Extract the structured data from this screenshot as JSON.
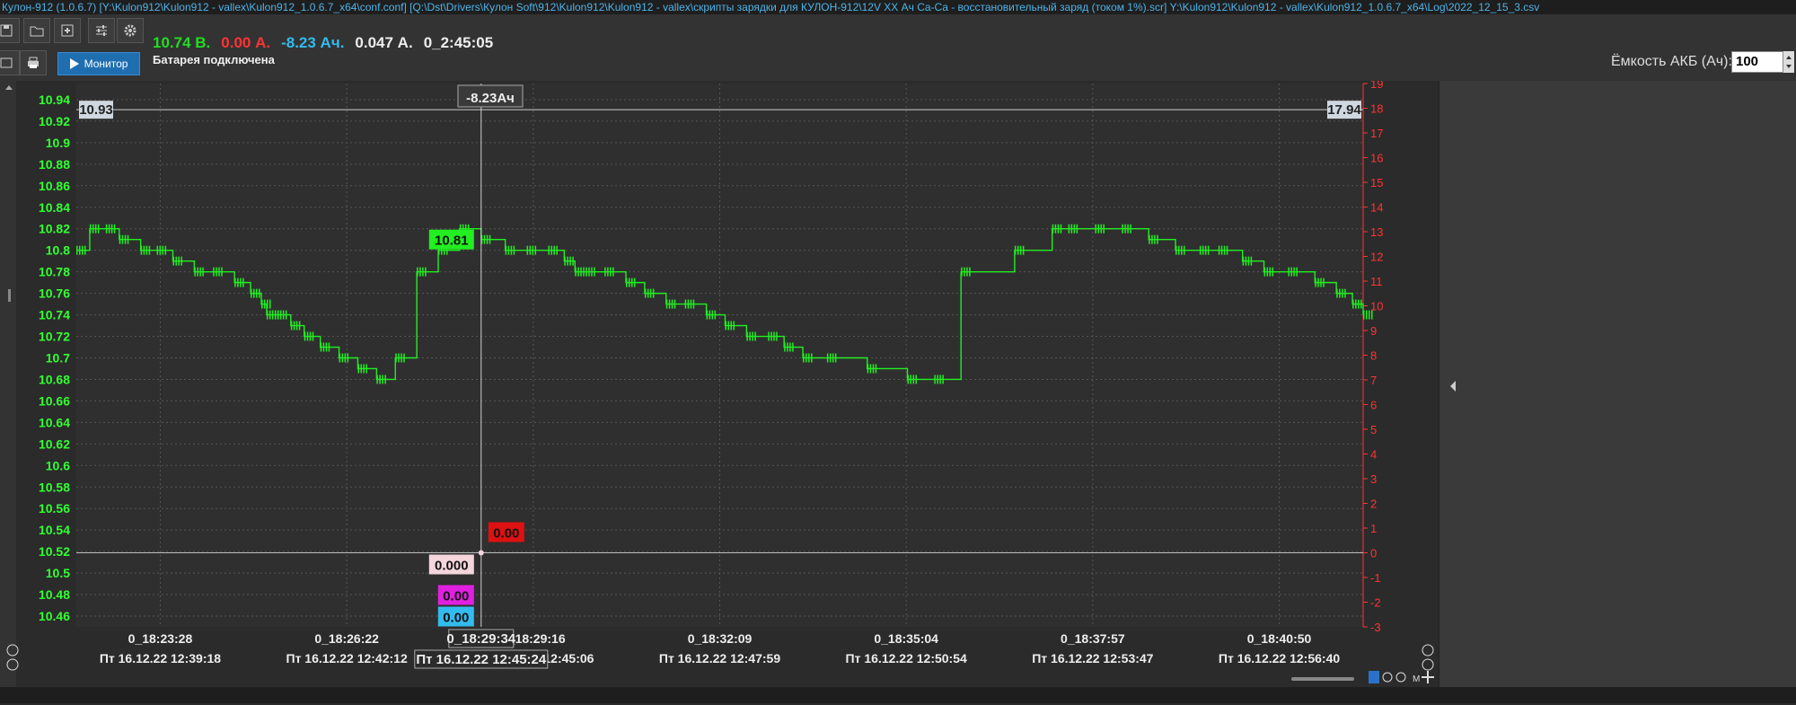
{
  "window": {
    "title": "Кулон-912 (1.0.6.7) [Y:\\Kulon912\\Kulon912 - vallex\\Kulon912_1.0.6.7_x64\\conf.conf] [Q:\\Dst\\Drivers\\Кулон Soft\\912\\Kulon912\\Kulon912 - vallex\\скрипты зарядки для КУЛОН-912\\12V XX Ач Ca-Ca - восстановительный заряд (током 1%).scr] Y:\\Kulon912\\Kulon912 - vallex\\Kulon912_1.0.6.7_x64\\Log\\2022_12_15_3.csv"
  },
  "status": {
    "voltage": "10.74 В.",
    "current": "0.00 А.",
    "capacity": "-8.23 Ач.",
    "power": "0.047 А.",
    "elapsed": "0_2:45:05",
    "battery_state": "Батарея подключена"
  },
  "toolbar": {
    "monitor_label": "Монитор",
    "capacity_label": "Ёмкость АКБ (Ач):",
    "capacity_value": "100"
  },
  "icons": [
    "save-icon",
    "open-icon",
    "add-icon",
    "settings-sliders-icon",
    "gear-icon",
    "export-icon",
    "print-icon",
    "play-icon"
  ],
  "chart_data": {
    "type": "line",
    "colors": {
      "line": "#22ee22",
      "right_axis": "#ff3333",
      "left_axis": "#33ff33",
      "grid": "#555555"
    },
    "y_left": {
      "ticks": [
        "10.94",
        "10.92",
        "10.9",
        "10.88",
        "10.86",
        "10.84",
        "10.82",
        "10.8",
        "10.78",
        "10.76",
        "10.74",
        "10.72",
        "10.7",
        "10.68",
        "10.66",
        "10.64",
        "10.62",
        "10.6",
        "10.58",
        "10.56",
        "10.54",
        "10.52",
        "10.5",
        "10.48",
        "10.46"
      ],
      "range": [
        10.45,
        10.955
      ]
    },
    "y_right": {
      "ticks": [
        "19",
        "18",
        "17",
        "16",
        "15",
        "14",
        "13",
        "12",
        "11",
        "10",
        "9",
        "8",
        "7",
        "6",
        "5",
        "4",
        "3",
        "2",
        "1",
        "0",
        "-1",
        "-2",
        "-3"
      ],
      "range": [
        -3,
        19
      ]
    },
    "x_ticks": [
      {
        "top": "0_18:23:28",
        "bottom": "Пт 16.12.22 12:39:18"
      },
      {
        "top": "0_18:26:22",
        "bottom": "Пт 16.12.22 12:42:12"
      },
      {
        "top": "0_18:29:16",
        "bottom": "Пт 16.12.22 12:45:06"
      },
      {
        "top": "0_18:32:09",
        "bottom": "Пт 16.12.22 12:47:59"
      },
      {
        "top": "0_18:35:04",
        "bottom": "Пт 16.12.22 12:50:54"
      },
      {
        "top": "0_18:37:57",
        "bottom": "Пт 16.12.22 12:53:47"
      },
      {
        "top": "0_18:40:50",
        "bottom": "Пт 16.12.22 12:56:40"
      }
    ],
    "cursor": {
      "top_label": "0_18:29:34",
      "bottom_label": "Пт 16.12.22 12:45:24",
      "capacity_label": "-8.23Ач",
      "voltage_value": "10.81",
      "current_value": "0.00",
      "value_white": "0.000",
      "value_magenta": "0.00",
      "value_cyan": "0.00"
    },
    "h_cursor": {
      "left_value": "10.93",
      "right_value": "17.94"
    },
    "series": [
      {
        "x": [
          0,
          10,
          22,
          32,
          48,
          60,
          72,
          88,
          102,
          118,
          130,
          138,
          142,
          146,
          150,
          160,
          170,
          182,
          196,
          210,
          224,
          238,
          254,
          270,
          286,
          302,
          320,
          336,
          352,
          364,
          372,
          380,
          394,
          410,
          424,
          440,
          454,
          470,
          484,
          500,
          516,
          528,
          542,
          560,
          590,
          620,
          640,
          660,
          700,
          728,
          740,
          760,
          780,
          800,
          820,
          838,
          852,
          870,
          886,
          904,
          924,
          940,
          952,
          960
        ],
        "y": [
          10.8,
          10.82,
          10.82,
          10.81,
          10.8,
          10.8,
          10.79,
          10.78,
          10.78,
          10.77,
          10.76,
          10.75,
          10.74,
          10.74,
          10.74,
          10.73,
          10.72,
          10.71,
          10.7,
          10.69,
          10.68,
          10.7,
          10.78,
          10.8,
          10.82,
          10.81,
          10.8,
          10.8,
          10.8,
          10.79,
          10.78,
          10.78,
          10.78,
          10.77,
          10.76,
          10.75,
          10.75,
          10.74,
          10.73,
          10.72,
          10.72,
          10.71,
          10.7,
          10.7,
          10.69,
          10.68,
          10.68,
          10.78,
          10.8,
          10.82,
          10.82,
          10.82,
          10.82,
          10.81,
          10.8,
          10.8,
          10.8,
          10.79,
          10.78,
          10.78,
          10.77,
          10.76,
          10.75,
          10.74
        ]
      }
    ]
  }
}
